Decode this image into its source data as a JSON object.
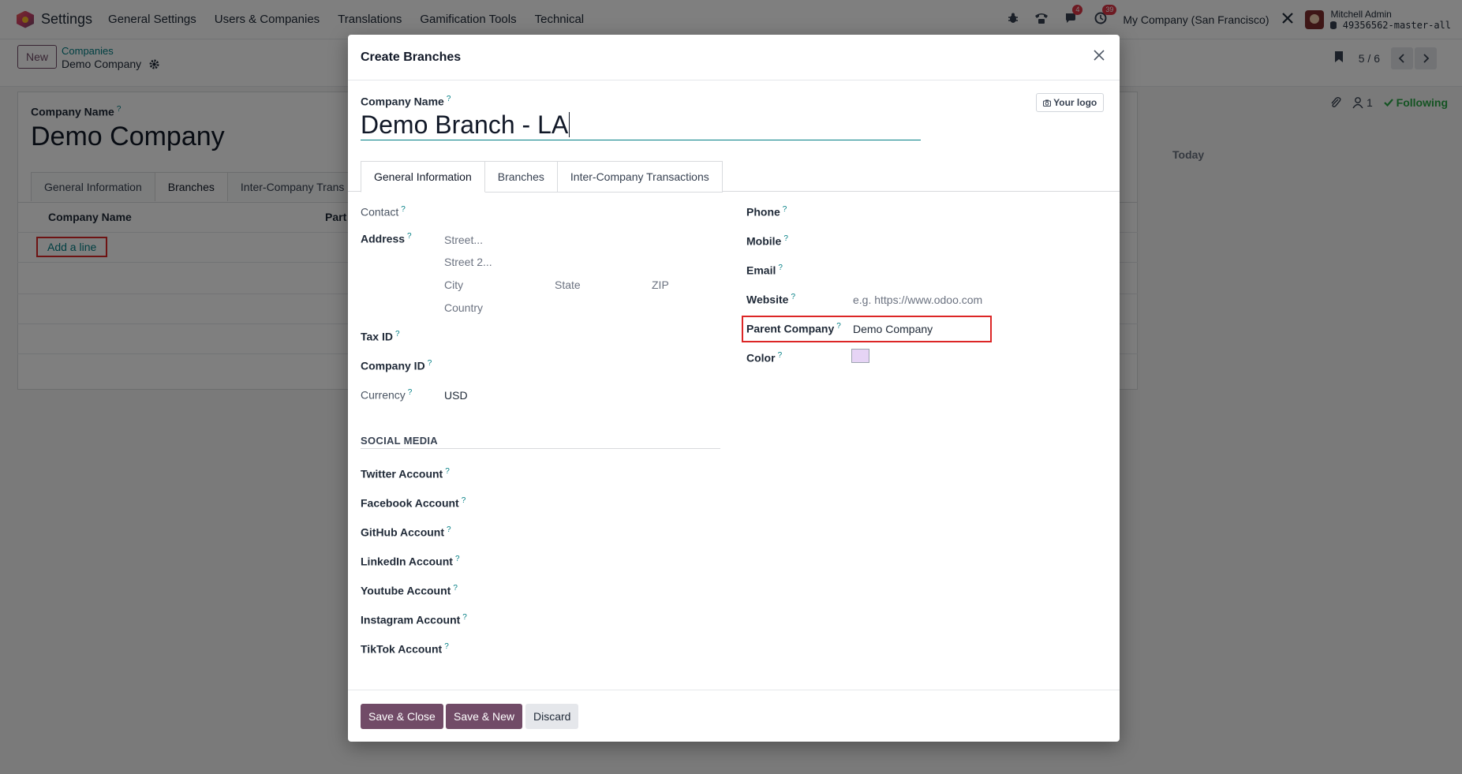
{
  "navbar": {
    "app_name": "Settings",
    "menu": [
      "General Settings",
      "Users & Companies",
      "Translations",
      "Gamification Tools",
      "Technical"
    ],
    "messages_badge": "4",
    "activities_badge": "39",
    "company": "My Company (San Francisco)",
    "user_name": "Mitchell Admin",
    "db_name": "49356562-master-all"
  },
  "control": {
    "new_label": "New",
    "breadcrumb_parent": "Companies",
    "breadcrumb_current": "Demo Company",
    "pager_value": "5 / 6"
  },
  "background": {
    "company_name_label": "Company Name",
    "company_name": "Demo Company",
    "tabs": [
      "General Information",
      "Branches",
      "Inter-Company Trans"
    ],
    "col_company_name": "Company Name",
    "col_partner": "Part",
    "add_line": "Add a line",
    "followers_count": "1",
    "following_label": "Following",
    "today_label": "Today"
  },
  "dialog": {
    "title": "Create Branches",
    "company_name_label": "Company Name",
    "company_name_value": "Demo Branch - LA",
    "logo_button": "Your logo",
    "tabs": [
      "General Information",
      "Branches",
      "Inter-Company Transactions"
    ],
    "contact_label": "Contact",
    "address_label": "Address",
    "street_placeholder": "Street...",
    "street2_placeholder": "Street 2...",
    "city_placeholder": "City",
    "state_placeholder": "State",
    "zip_placeholder": "ZIP",
    "country_placeholder": "Country",
    "tax_id_label": "Tax ID",
    "company_id_label": "Company ID",
    "currency_label": "Currency",
    "currency_value": "USD",
    "social_section": "SOCIAL MEDIA",
    "twitter_label": "Twitter Account",
    "facebook_label": "Facebook Account",
    "github_label": "GitHub Account",
    "linkedin_label": "LinkedIn Account",
    "youtube_label": "Youtube Account",
    "instagram_label": "Instagram Account",
    "tiktok_label": "TikTok Account",
    "phone_label": "Phone",
    "mobile_label": "Mobile",
    "email_label": "Email",
    "website_label": "Website",
    "website_placeholder": "e.g. https://www.odoo.com",
    "parent_company_label": "Parent Company",
    "parent_company_value": "Demo Company",
    "color_label": "Color",
    "color_value": "#e6d4f5",
    "help_mark": "?",
    "save_close": "Save & Close",
    "save_new": "Save & New",
    "discard": "Discard"
  }
}
